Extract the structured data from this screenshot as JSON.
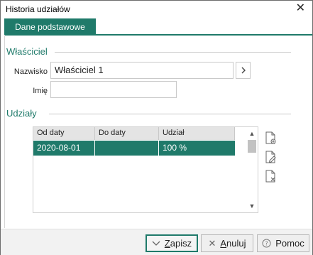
{
  "window": {
    "title": "Historia udziałów"
  },
  "tabs": [
    {
      "label": "Dane podstawowe"
    }
  ],
  "owner_section": {
    "title": "Właściciel",
    "name_label": "Nazwisko",
    "name_value": "Właściciel 1",
    "first_name_label": "Imię",
    "first_name_value": ""
  },
  "shares_section": {
    "title": "Udziały",
    "columns": [
      "Od daty",
      "Do daty",
      "Udział"
    ],
    "rows": [
      {
        "from": "2020-08-01",
        "to": "",
        "share": "100 %"
      }
    ]
  },
  "buttons": {
    "save_prefix": "",
    "save_hotkey": "Z",
    "save_rest": "apisz",
    "cancel_hotkey": "A",
    "cancel_rest": "nuluj",
    "help_label": "Pomoc"
  },
  "icons": {
    "close": "close-icon",
    "lookup": "chevron-right-icon",
    "add": "add-document-icon",
    "edit": "edit-document-icon",
    "delete": "delete-document-icon"
  },
  "colors": {
    "accent": "#1f7a6a"
  }
}
